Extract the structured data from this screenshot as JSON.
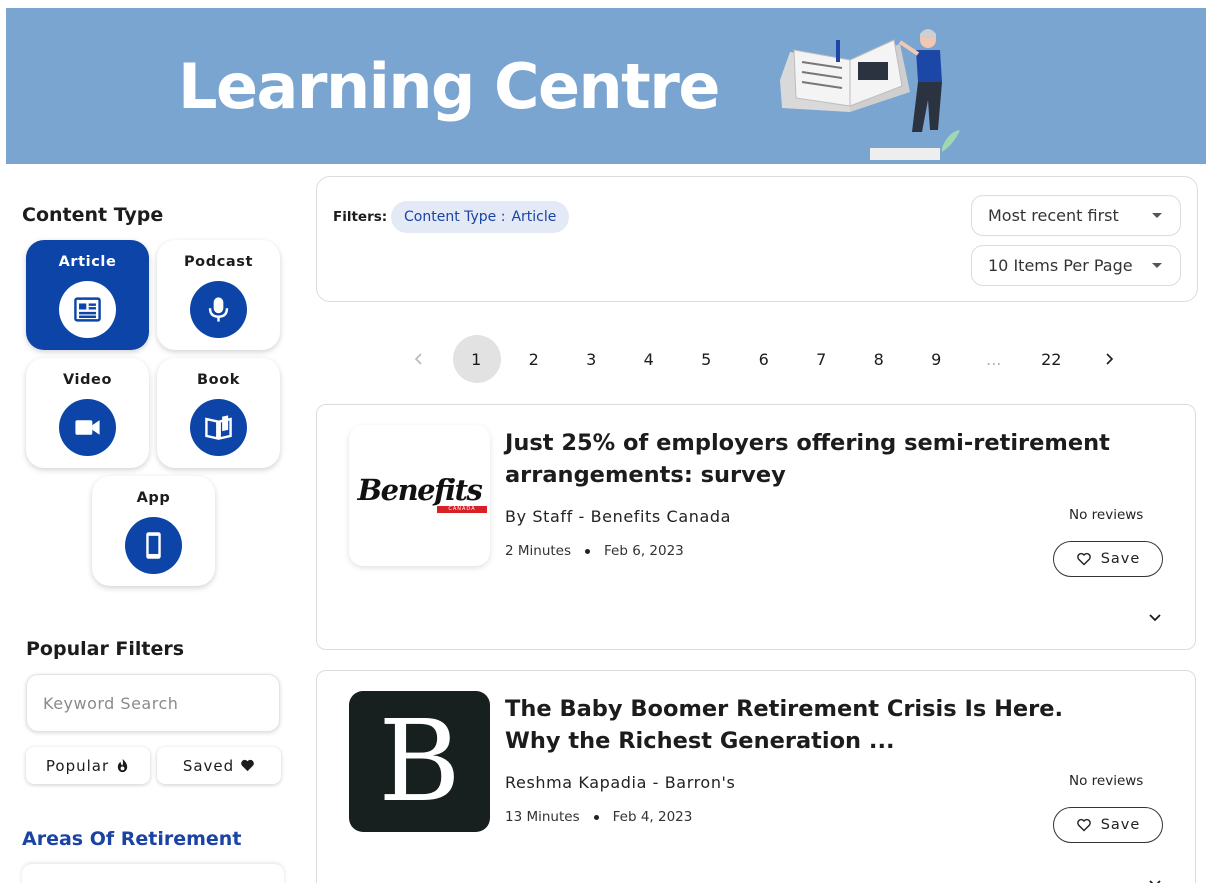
{
  "banner": {
    "title": "Learning Centre"
  },
  "sidebar": {
    "content_type_title": "Content Type",
    "content_types": [
      {
        "label": "Article",
        "icon": "article-icon",
        "active": true
      },
      {
        "label": "Podcast",
        "icon": "microphone-icon",
        "active": false
      },
      {
        "label": "Video",
        "icon": "video-camera-icon",
        "active": false
      },
      {
        "label": "Book",
        "icon": "book-icon",
        "active": false
      },
      {
        "label": "App",
        "icon": "phone-icon",
        "active": false
      }
    ],
    "popular_filters_title": "Popular Filters",
    "keyword_placeholder": "Keyword Search",
    "popular_label": "Popular",
    "saved_label": "Saved",
    "areas_title": "Areas Of Retirement"
  },
  "filters": {
    "label": "Filters:",
    "chip_key": "Content Type :",
    "chip_value": "Article",
    "sort_value": "Most recent first",
    "per_page_value": "10 Items Per Page"
  },
  "pagination": {
    "pages": [
      "1",
      "2",
      "3",
      "4",
      "5",
      "6",
      "7",
      "8",
      "9",
      "...",
      "22"
    ],
    "current": "1"
  },
  "articles": [
    {
      "title": "Just 25% of employers offering semi-retirement arrangements: survey",
      "source": "By Staff - Benefits Canada",
      "duration": "2 Minutes",
      "date": "Feb 6, 2023",
      "reviews": "No reviews",
      "save_label": "Save",
      "thumb_text": "Benefits",
      "thumb_subtext": "CANADA"
    },
    {
      "title": "The Baby Boomer Retirement Crisis Is Here. Why the Richest Generation ...",
      "source": "Reshma Kapadia - Barron's",
      "duration": "13 Minutes",
      "date": "Feb 4, 2023",
      "reviews": "No reviews",
      "save_label": "Save",
      "thumb_text": "B"
    }
  ],
  "colors": {
    "banner_bg": "#7ba5d1",
    "brand_blue": "#0c44a8",
    "chip_bg": "#e3eaf6"
  }
}
